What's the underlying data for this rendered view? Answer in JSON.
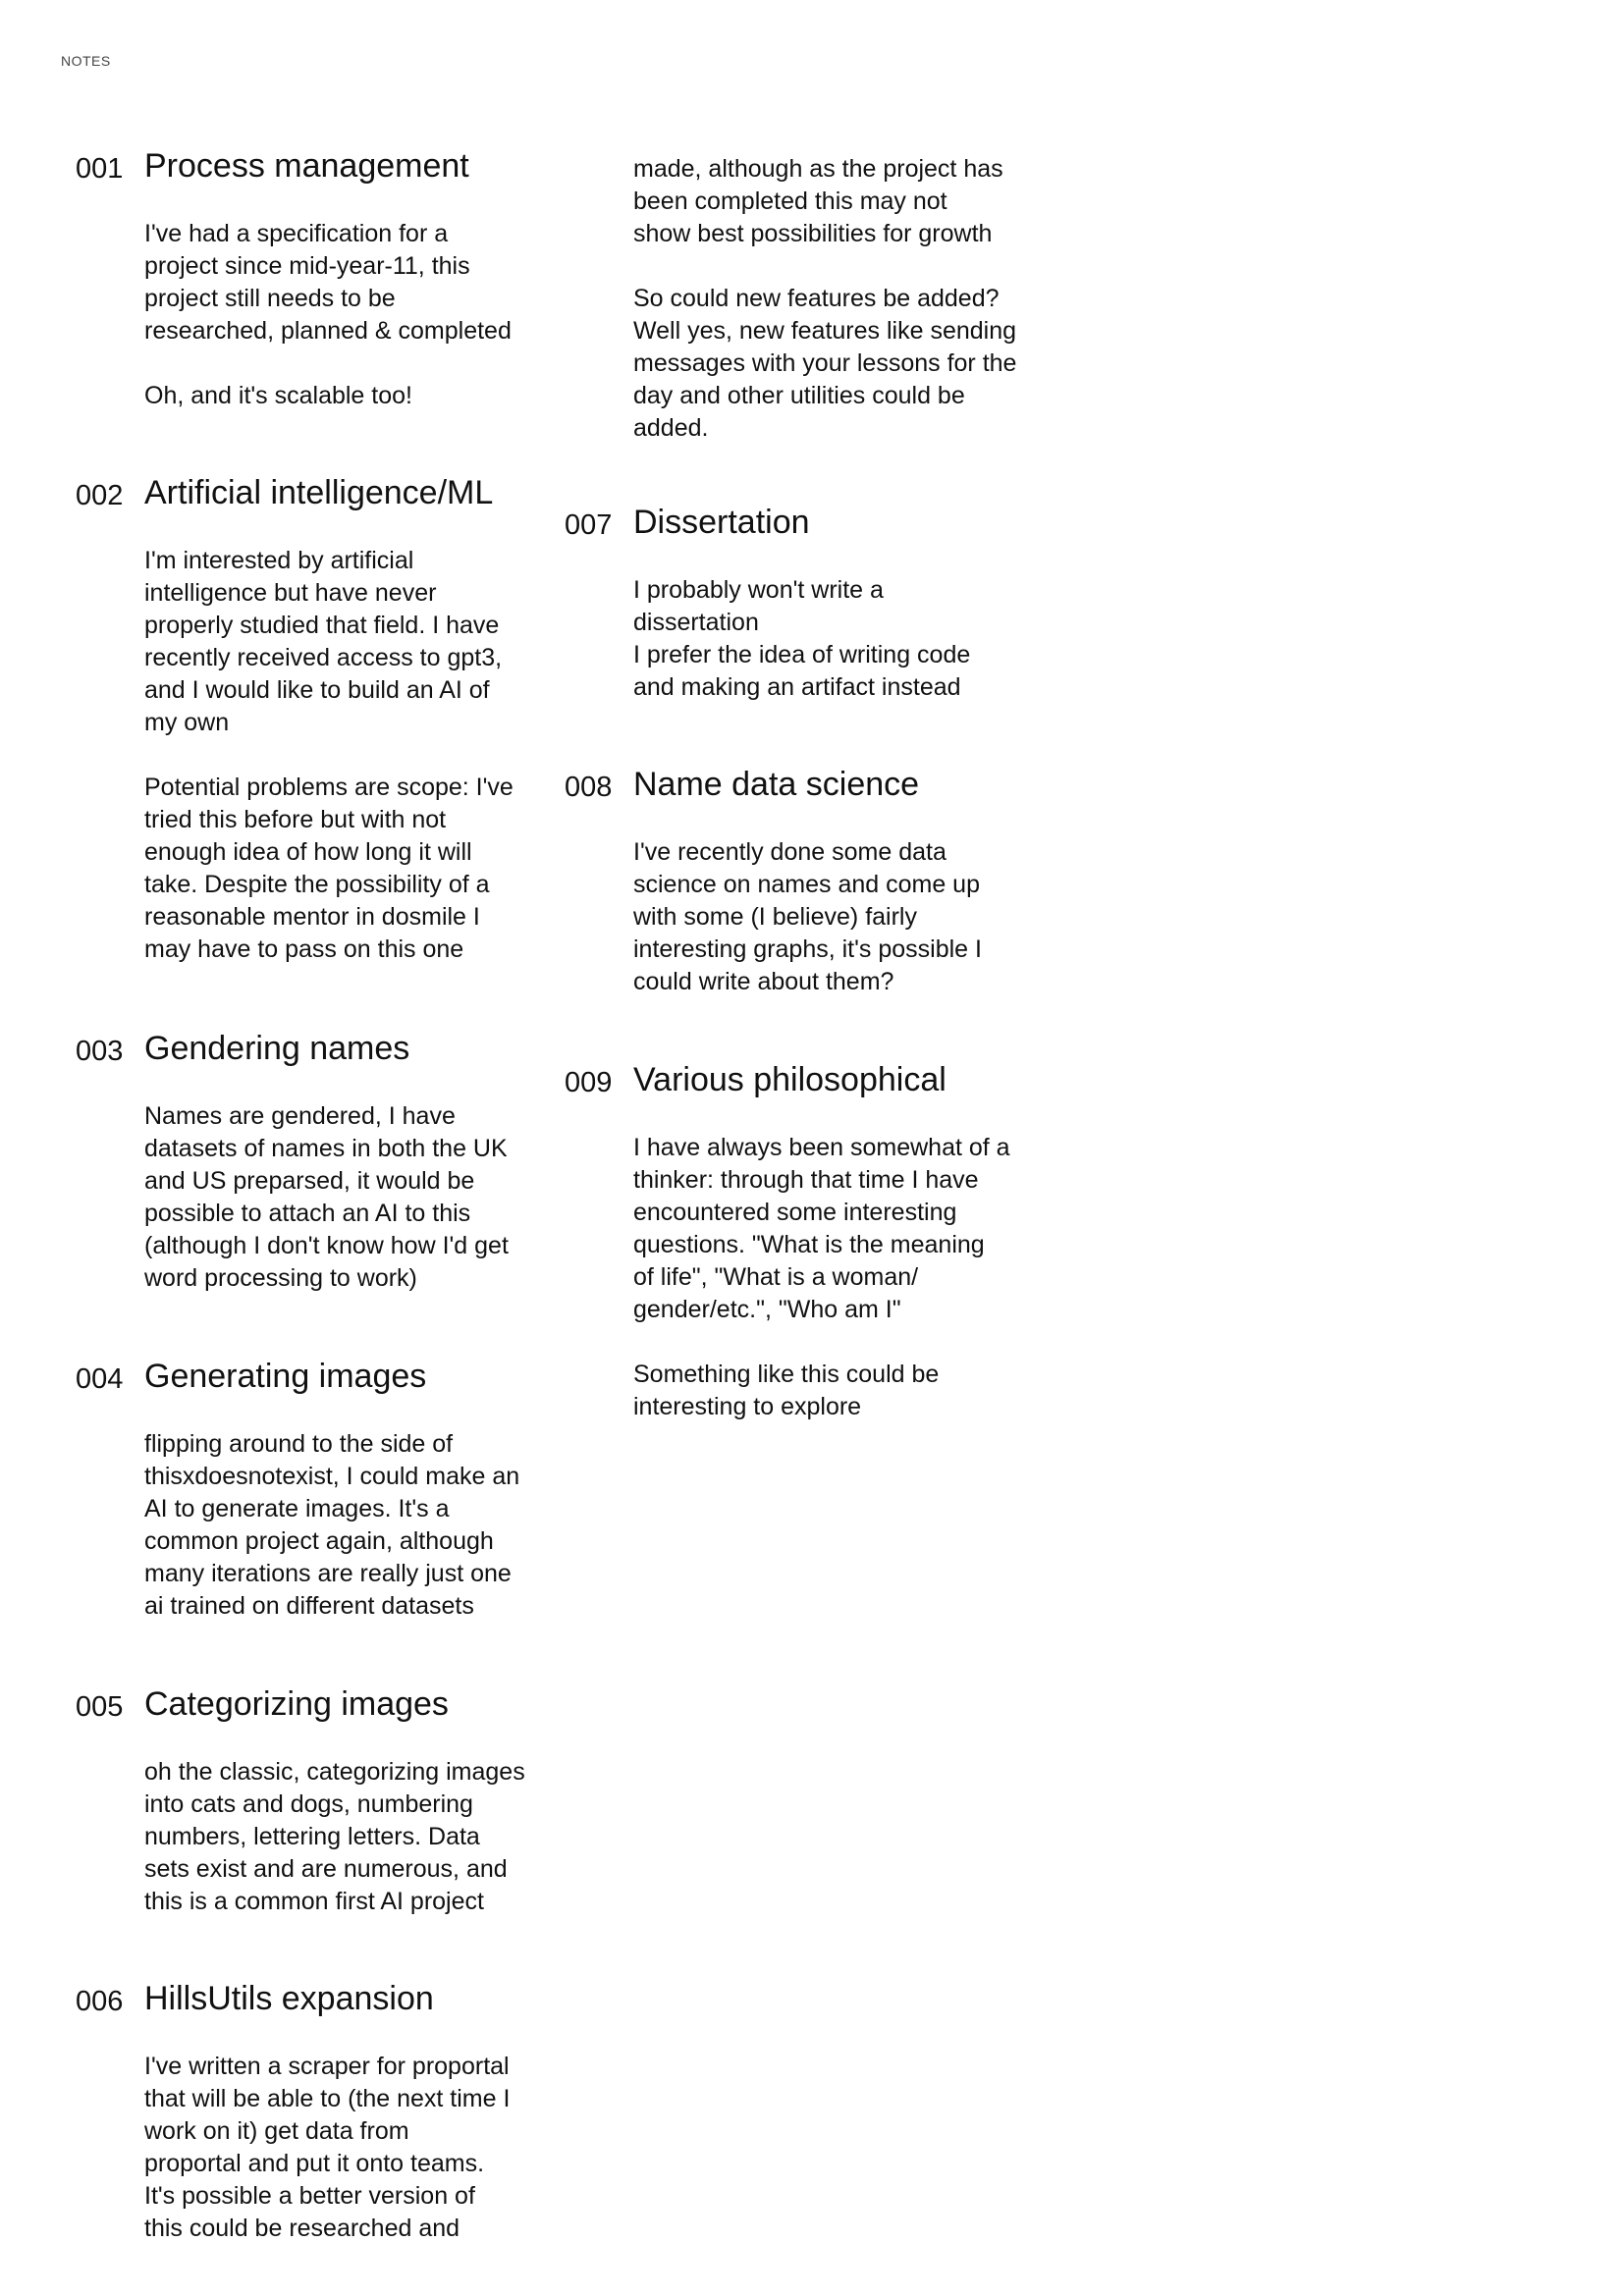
{
  "header": {
    "label": "NOTES"
  },
  "notes": [
    {
      "number": "001",
      "title": "Process management",
      "paragraphs": [
        [
          "I've had a specification for a",
          "project since mid-year-11, this",
          "project still needs to be",
          "researched, planned & completed"
        ],
        [
          "Oh, and it's scalable too!"
        ]
      ]
    },
    {
      "number": "002",
      "title": "Artificial intelligence/ML",
      "paragraphs": [
        [
          "I'm interested by artificial",
          "intelligence but have never",
          "properly studied that field. I have",
          "recently received access to gpt3,",
          "and I would like to build an AI of",
          "my own"
        ],
        [
          "Potential problems are scope: I've",
          "tried this before but with not",
          "enough idea of how long it will",
          "take. Despite the possibility of a",
          "reasonable mentor in dosmile I",
          "may have to pass on this one"
        ]
      ]
    },
    {
      "number": "003",
      "title": "Gendering names",
      "paragraphs": [
        [
          "Names are gendered, I have",
          "datasets of names in both the UK",
          "and US preparsed, it would be",
          "possible to attach an AI to this",
          "(although I don't know how I'd get",
          "word processing to work)"
        ]
      ]
    },
    {
      "number": "004",
      "title": "Generating images",
      "paragraphs": [
        [
          "flipping around to the side of",
          "thisxdoesnotexist, I could make an",
          "AI to generate images. It's a",
          "common project again, although",
          "many iterations are really just one",
          "ai trained on different datasets"
        ]
      ]
    },
    {
      "number": "005",
      "title": "Categorizing images",
      "paragraphs": [
        [
          "oh the classic, categorizing images",
          "into cats and dogs, numbering",
          "numbers, lettering letters. Data",
          "sets exist and are numerous, and",
          "this is a common first AI project"
        ]
      ]
    },
    {
      "number": "006",
      "title": "HillsUtils expansion",
      "paragraphs": [
        [
          "I've written a scraper for proportal",
          "that will be able to (the next time I",
          "work on it) get data from",
          "proportal and put it onto teams.",
          "It's possible a better version of",
          "this could be researched and"
        ]
      ]
    },
    {
      "number": "",
      "title": "",
      "paragraphs": [
        [
          "made, although as the project has",
          "been completed this may not",
          "show best possibilities for growth"
        ],
        [
          "So could new features be added?",
          "Well yes, new features like sending",
          "messages with your lessons for the",
          "day and other utilities could be",
          "added."
        ]
      ]
    },
    {
      "number": "007",
      "title": "Dissertation",
      "paragraphs": [
        [
          "I probably won't write a",
          "dissertation",
          "I prefer the idea of writing code",
          "and making an artifact instead"
        ]
      ]
    },
    {
      "number": "008",
      "title": "Name data science",
      "paragraphs": [
        [
          "I've recently done some data",
          "science on names and come up",
          "with some (I believe) fairly",
          "interesting graphs, it's possible I",
          "could write about them?"
        ]
      ]
    },
    {
      "number": "009",
      "title": "Various philosophical",
      "paragraphs": [
        [
          "I have always been somewhat of a",
          "thinker: through that time I have",
          "encountered some interesting",
          "questions. \"What is the meaning",
          "of life\", \"What is a woman/",
          "gender/etc.\", \"Who am I\""
        ],
        [
          "Something like this could be",
          "interesting to explore"
        ]
      ]
    }
  ]
}
